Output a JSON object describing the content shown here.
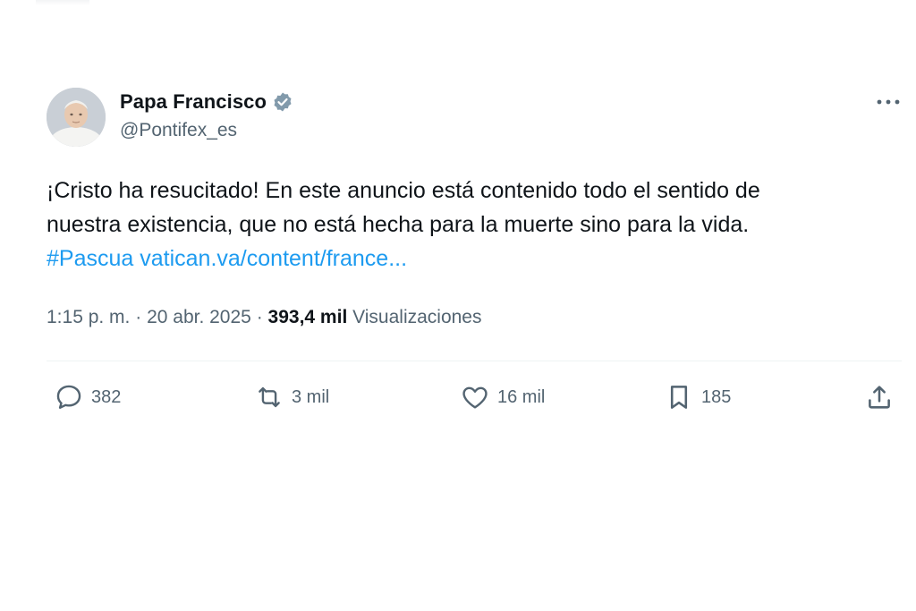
{
  "author": {
    "display_name": "Papa Francisco",
    "handle": "@Pontifex_es",
    "verified": true
  },
  "tweet": {
    "line1": "¡Cristo ha resucitado! En este anuncio está contenido todo el sentido de",
    "line2": "nuestra existencia, que no está hecha para la muerte sino para la vida.",
    "hashtag": "#Pascua",
    "link": "vatican.va/content/france..."
  },
  "meta": {
    "time": "1:15 p. m.",
    "separator": "·",
    "date": "20 abr. 2025",
    "views_count": "393,4 mil",
    "views_label": "Visualizaciones"
  },
  "actions": {
    "replies": "382",
    "reposts": "3 mil",
    "likes": "16 mil",
    "bookmarks": "185"
  },
  "colors": {
    "link": "#1d9bf0",
    "secondary_text": "#536471",
    "primary_text": "#0f1419",
    "verified_badge": "#829aab"
  },
  "icons": {
    "more": "more-dots-icon",
    "verified": "verified-badge-icon",
    "reply": "reply-bubble-icon",
    "repost": "repost-arrows-icon",
    "like": "heart-icon",
    "bookmark": "bookmark-icon",
    "share": "share-upload-icon"
  }
}
